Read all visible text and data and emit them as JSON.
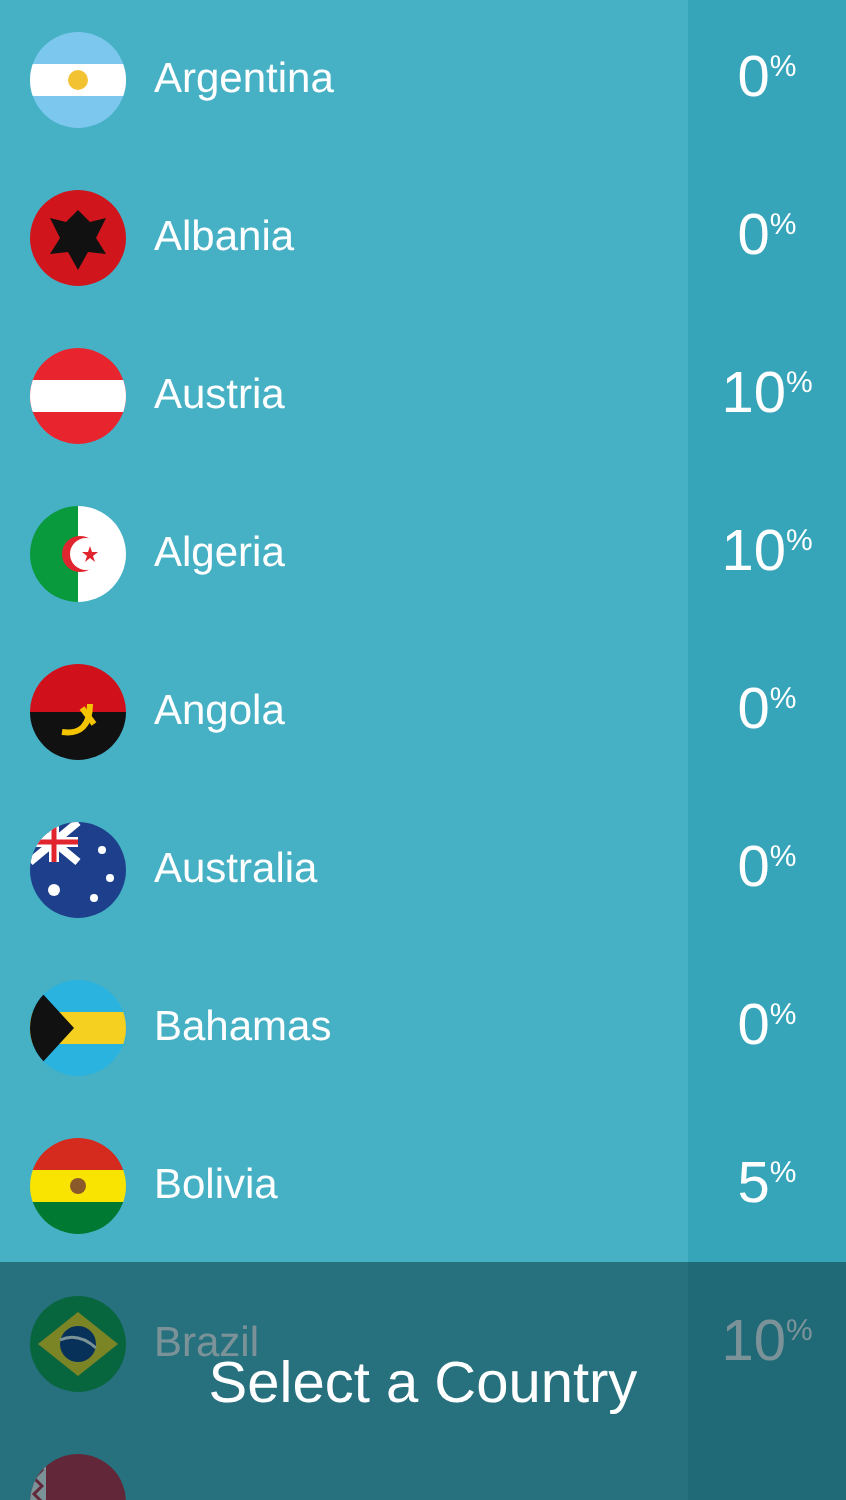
{
  "countries": [
    {
      "name": "Argentina",
      "value": "0",
      "unit": "%"
    },
    {
      "name": "Albania",
      "value": "0",
      "unit": "%"
    },
    {
      "name": "Austria",
      "value": "10",
      "unit": "%"
    },
    {
      "name": "Algeria",
      "value": "10",
      "unit": "%"
    },
    {
      "name": "Angola",
      "value": "0",
      "unit": "%"
    },
    {
      "name": "Australia",
      "value": "0",
      "unit": "%"
    },
    {
      "name": "Bahamas",
      "value": "0",
      "unit": "%"
    },
    {
      "name": "Bolivia",
      "value": "5",
      "unit": "%"
    },
    {
      "name": "Brazil",
      "value": "10",
      "unit": "%"
    }
  ],
  "footer": {
    "title": "Select a Country"
  }
}
